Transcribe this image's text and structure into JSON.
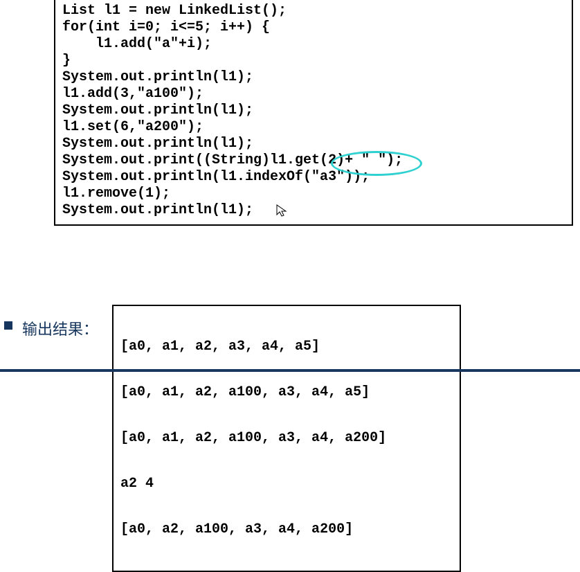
{
  "code": {
    "lines": [
      "List l1 = new LinkedList();",
      "for(int i=0; i<=5; i++) {",
      "    l1.add(\"a\"+i);",
      "}",
      "System.out.println(l1);",
      "l1.add(3,\"a100\");",
      "System.out.println(l1);",
      "l1.set(6,\"a200\");",
      "System.out.println(l1);",
      "System.out.print((String)l1.get(2)+ \" \");",
      "System.out.println(l1.indexOf(\"a3\"));",
      "l1.remove(1);",
      "System.out.println(l1);"
    ],
    "highlighted_expression": "l1.get(2)"
  },
  "output": {
    "label": "输出结果：",
    "lines": [
      "[a0, a1, a2, a3, a4, a5]",
      "[a0, a1, a2, a100, a3, a4, a5]",
      "[a0, a1, a2, a100, a3, a4, a200]",
      "a2 4",
      "[a0, a2, a100, a3, a4, a200]"
    ]
  }
}
